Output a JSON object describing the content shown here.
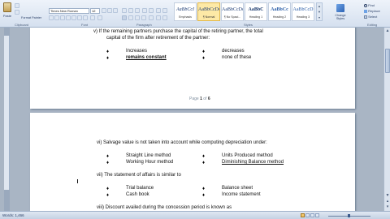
{
  "ribbon": {
    "paste_label": "Paste",
    "clipboard_label": "Clipboard",
    "format_painter_label": "Format Painter",
    "font_name": "Times New Roman",
    "font_size": "12",
    "font_group_label": "Font",
    "paragraph_group_label": "Paragraph",
    "styles_group_label": "Styles",
    "styles": [
      {
        "preview": "AaBbCcI",
        "name": "Emphasis"
      },
      {
        "preview": "AaBbCcDc",
        "name": "¶ Normal"
      },
      {
        "preview": "AaBbCcDc",
        "name": "¶ No Spaci..."
      },
      {
        "preview": "AaBbC",
        "name": "Heading 1"
      },
      {
        "preview": "AaBbCc",
        "name": "Heading 2"
      },
      {
        "preview": "AaBbCcD",
        "name": "Heading 3"
      }
    ],
    "change_styles_label": "Change Styles",
    "find_label": "Find",
    "replace_label": "Replace",
    "select_label": "Select",
    "editing_label": "Editing"
  },
  "page1": {
    "q5_line1": "v)   If the remaining partners purchase the capital of the retiring partner, the total",
    "q5_line2": "capital of the firm after retirement of the partner:",
    "opt_a": "Increases",
    "opt_b": "decreases",
    "opt_c": "remains constant",
    "opt_d": "none of these",
    "page_num_prefix": "Page",
    "page_current": "1",
    "page_of": "of",
    "page_total": "6"
  },
  "page2": {
    "q6": "vi)   Salvage value is not taken into account while computing depreciation under:",
    "q6_a": "Straight Line method",
    "q6_b": "Units Produced method",
    "q6_c": "Working Hour method",
    "q6_d": "Diminishing Balance method",
    "q7": "vii)  The statement of affairs is similar to",
    "q7_a": "Trial balance",
    "q7_b": "Balance sheet",
    "q7_c": "Cash book",
    "q7_d": "Income statement",
    "q8": "viii)   Discount availed during the concession period is known as"
  },
  "status": {
    "words": "Words: 1,466"
  },
  "icons": {
    "bullet": "♦"
  }
}
